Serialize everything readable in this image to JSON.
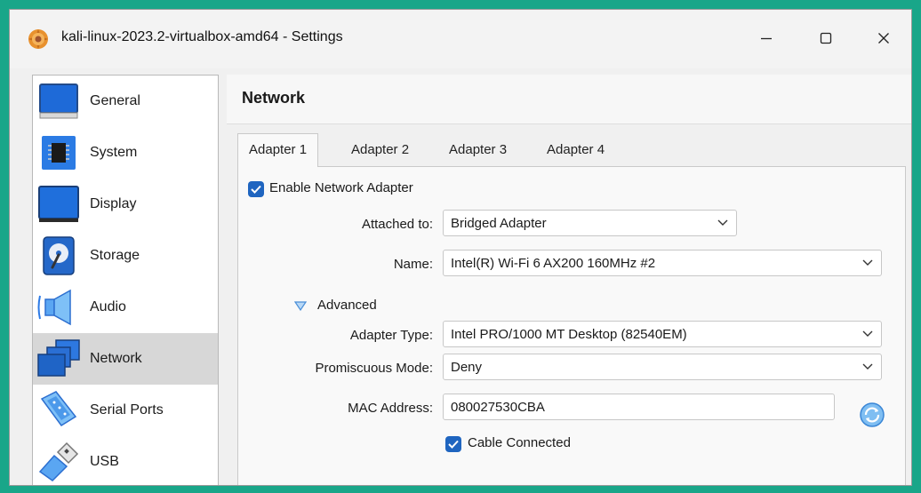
{
  "window": {
    "title": "kali-linux-2023.2-virtualbox-amd64 - Settings",
    "controls": [
      "minimize",
      "maximize",
      "close"
    ]
  },
  "sidebar": {
    "items": [
      {
        "label": "General",
        "icon": "general-icon"
      },
      {
        "label": "System",
        "icon": "chip-icon"
      },
      {
        "label": "Display",
        "icon": "monitor-icon"
      },
      {
        "label": "Storage",
        "icon": "storage-disk-icon"
      },
      {
        "label": "Audio",
        "icon": "speaker-icon"
      },
      {
        "label": "Network",
        "icon": "network-icon",
        "selected": true
      },
      {
        "label": "Serial Ports",
        "icon": "serial-port-icon"
      },
      {
        "label": "USB",
        "icon": "usb-icon"
      }
    ]
  },
  "page": {
    "title": "Network"
  },
  "tabs": [
    {
      "label": "Adapter 1",
      "active": true
    },
    {
      "label": "Adapter 2"
    },
    {
      "label": "Adapter 3"
    },
    {
      "label": "Adapter 4"
    }
  ],
  "adapter": {
    "enable_label": "Enable Network Adapter",
    "enabled": true,
    "attached_to": {
      "label": "Attached to:",
      "value": "Bridged Adapter"
    },
    "name": {
      "label": "Name:",
      "value": "Intel(R) Wi-Fi 6 AX200 160MHz #2"
    },
    "advanced_label": "Advanced",
    "advanced_expanded": true,
    "adapter_type": {
      "label": "Adapter Type:",
      "value": "Intel PRO/1000 MT Desktop (82540EM)"
    },
    "promiscuous_mode": {
      "label": "Promiscuous Mode:",
      "value": "Deny"
    },
    "mac_address": {
      "label": "MAC Address:",
      "value": "080027530CBA"
    },
    "cable_connected_label": "Cable Connected",
    "cable_connected": true
  },
  "colors": {
    "background": "#19a689",
    "accent": "#1f65c0",
    "selected_item": "#d7d7d7"
  }
}
